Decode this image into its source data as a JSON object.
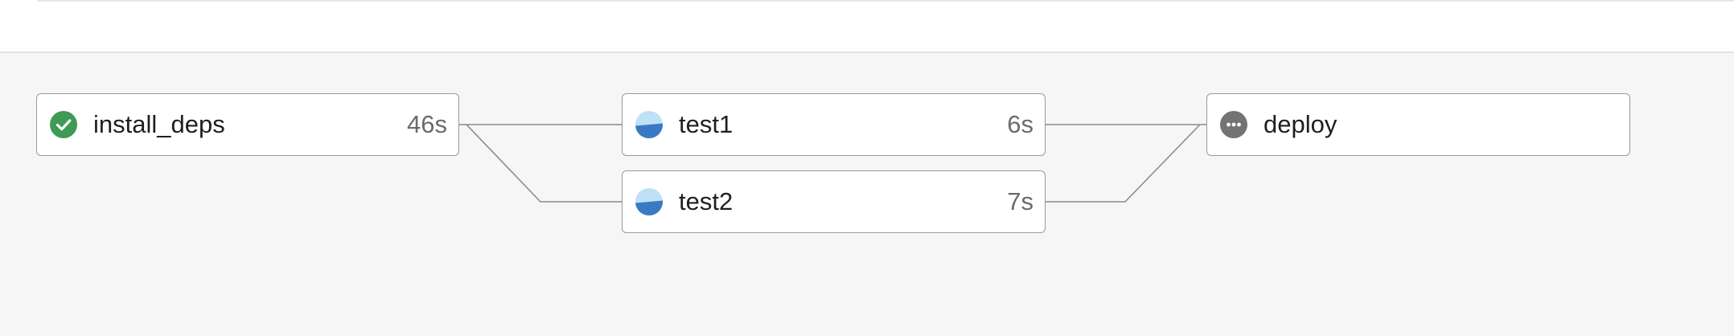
{
  "colors": {
    "success": "#3f9a55",
    "running_light": "#bfe1f7",
    "running_dark": "#3a7ac4",
    "waiting": "#737373",
    "canvas": "#f6f6f6",
    "edge": "#8a8a8a"
  },
  "pipeline": {
    "jobs": [
      {
        "name": "install_deps",
        "duration": "46s",
        "status": "success",
        "icon": "check-circle-icon"
      },
      {
        "name": "test1",
        "duration": "6s",
        "status": "running",
        "icon": "running-half-circle-icon"
      },
      {
        "name": "test2",
        "duration": "7s",
        "status": "running",
        "icon": "running-half-circle-icon"
      },
      {
        "name": "deploy",
        "duration": "",
        "status": "waiting",
        "icon": "more-dots-icon"
      }
    ]
  }
}
